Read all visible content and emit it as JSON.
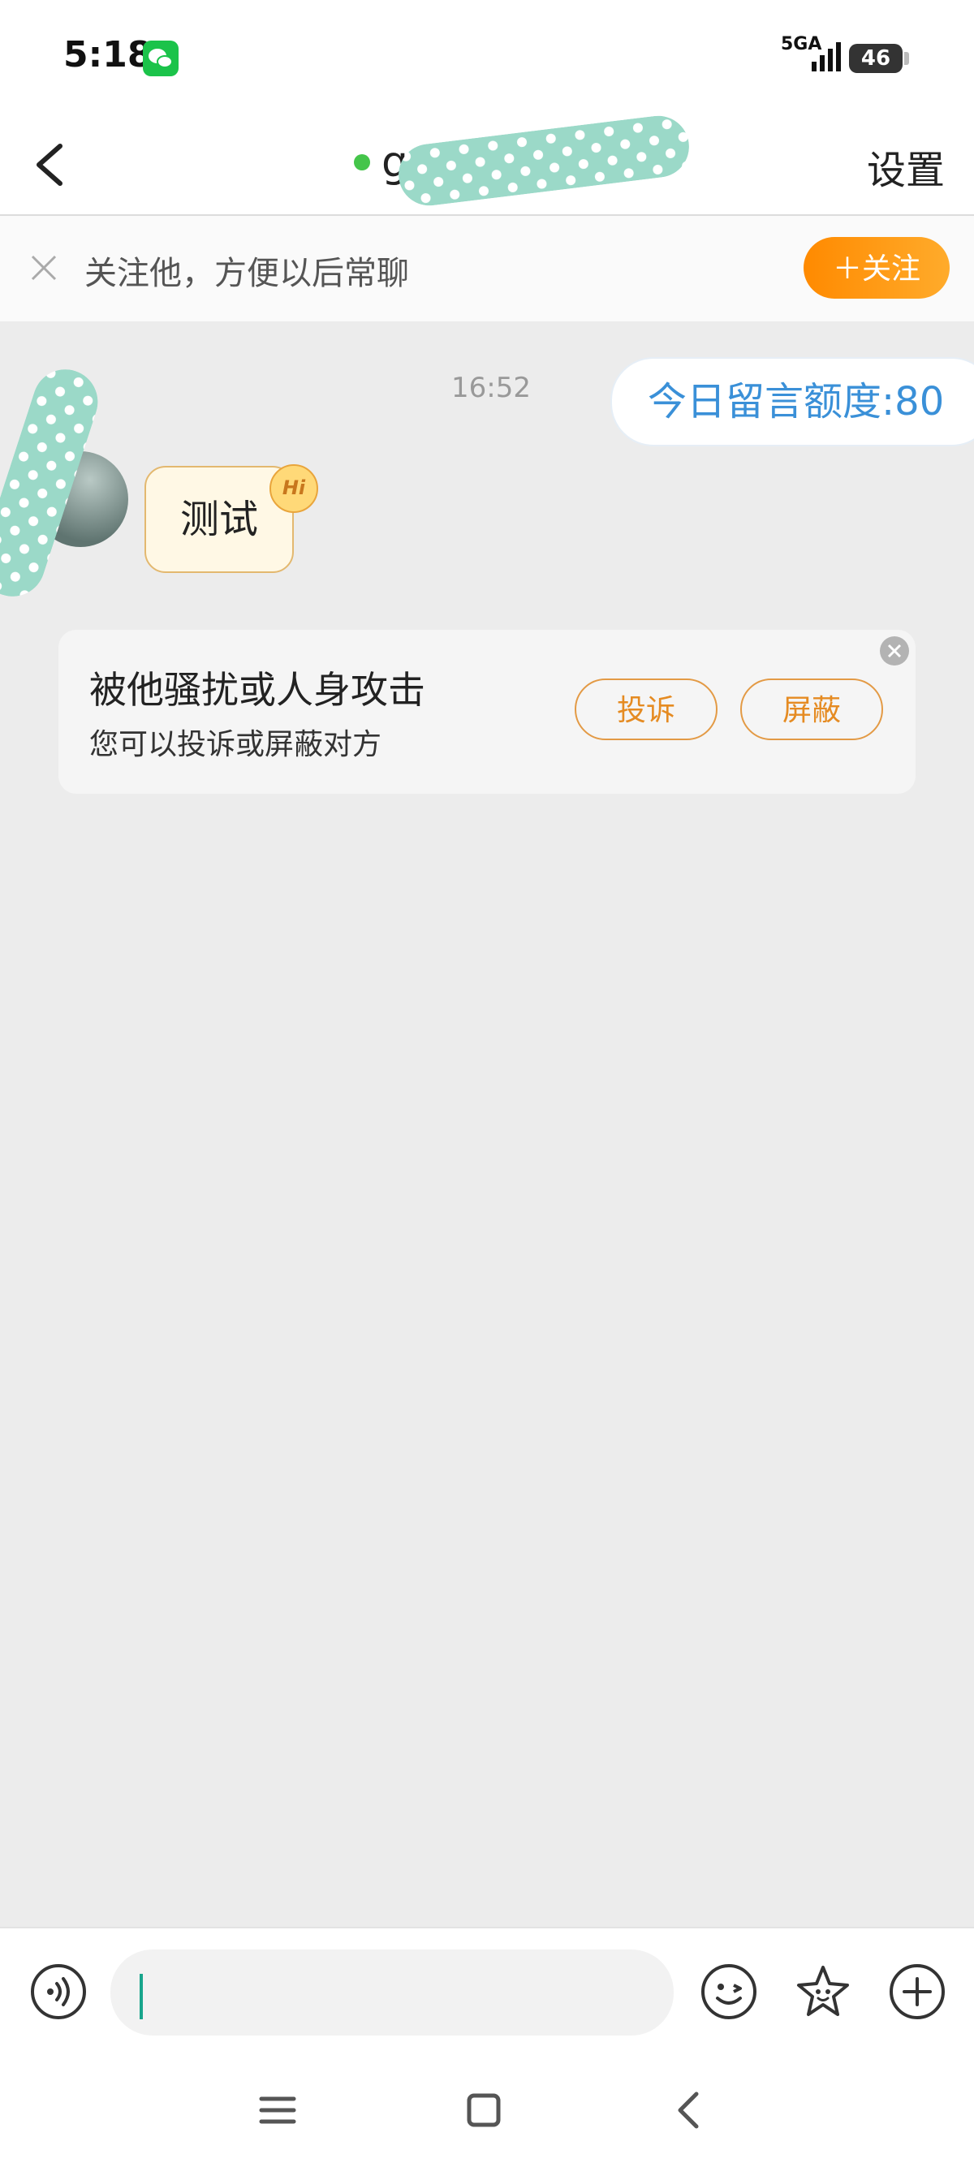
{
  "status_bar": {
    "time": "5:18",
    "network": "5GA",
    "battery": "46"
  },
  "header": {
    "title": "g",
    "settings_label": "设置"
  },
  "follow_banner": {
    "text": "关注他，方便以后常聊",
    "button_label": "＋关注"
  },
  "chat": {
    "timestamp": "16:52",
    "quota_text": "今日留言额度:80",
    "message_text": "测试",
    "hi_badge": "Hi"
  },
  "report_card": {
    "title": "被他骚扰或人身攻击",
    "subtitle": "您可以投诉或屏蔽对方",
    "report_button": "投诉",
    "block_button": "屏蔽"
  },
  "input_bar": {
    "value": ""
  },
  "colors": {
    "accent_orange": "#ff8a00",
    "quota_blue": "#3a90d8",
    "online_green": "#44c54a",
    "mask_teal": "#9bd9c8"
  }
}
